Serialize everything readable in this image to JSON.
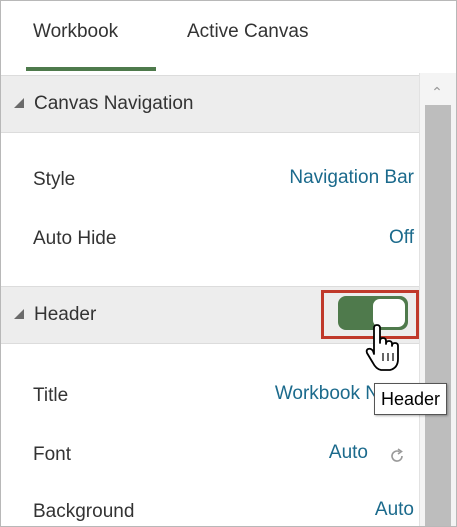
{
  "tabs": [
    {
      "label": "Workbook",
      "active": true
    },
    {
      "label": "Active Canvas",
      "active": false
    }
  ],
  "canvas_navigation": {
    "title": "Canvas Navigation",
    "rows": [
      {
        "label": "Style",
        "value": "Navigation Bar"
      },
      {
        "label": "Auto Hide",
        "value": "Off"
      }
    ]
  },
  "header_section": {
    "title": "Header",
    "toggle_on": true,
    "tooltip": "Header",
    "rows": [
      {
        "label": "Title",
        "value": "Workbook N"
      },
      {
        "label": "Font",
        "value": "Auto"
      },
      {
        "label": "Background",
        "value": "Auto"
      }
    ]
  },
  "colors": {
    "accent_green": "#4f7a4c",
    "link_blue": "#1b6a8c",
    "highlight_red": "#c0392b"
  },
  "icons": {
    "collapse": "triangle-icon",
    "reset": "refresh-icon",
    "cursor": "hand-pointer-icon",
    "scroll_up": "chevron-up-icon"
  }
}
